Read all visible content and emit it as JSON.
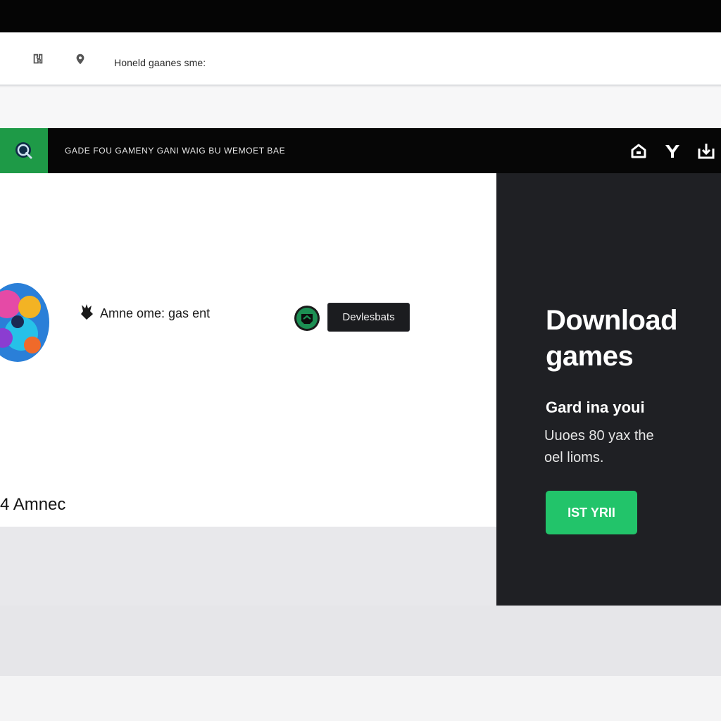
{
  "address_bar": {
    "back_icon": "puzzle-icon",
    "location_icon": "location-pin-icon",
    "text": "Honeld gaanes sme:"
  },
  "navbar": {
    "logo_icon": "search-icon",
    "logo_color": "#1e9a47",
    "tagline": "GADE FOU GAMENY GANI WAIG BU WEMOET BAE",
    "actions": [
      {
        "name": "home-icon"
      },
      {
        "name": "controller-icon"
      },
      {
        "name": "download-icon"
      }
    ]
  },
  "main": {
    "game_avatar_icon": "game-art-icon",
    "crest_icon": "crest-icon",
    "game_name": "Amne ome: gas ent",
    "brand_badge_icon": "brand-badge-icon",
    "dev_button_label": "Devlesbats",
    "count_label": "4 Amnec"
  },
  "side_panel": {
    "title": "Download\ngames",
    "subtitle": "Gard ina youi",
    "description": "Uuoes 80 yax the\noel lioms.",
    "cta_label": "IST YRII",
    "cta_color": "#22c46a",
    "background": "#1f2024"
  }
}
